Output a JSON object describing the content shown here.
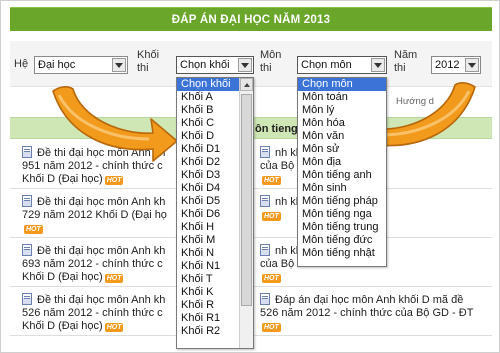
{
  "header": {
    "title": "ĐÁP ÁN ĐẠI HỌC NĂM 2013"
  },
  "filters": {
    "he_label": "Hệ",
    "he_value": "Đại học",
    "khoi_label_1": "Khối",
    "khoi_label_2": "thi",
    "khoi_value": "Chọn khối",
    "mon_label_1": "Môn",
    "mon_label_2": "thi",
    "mon_value": "Chọn môn",
    "nam_label_1": "Năm",
    "nam_label_2": "thi",
    "nam_value": "2012"
  },
  "hint_text": "Hướng d",
  "strip_text": "ôn tieng",
  "khoi_options": [
    "Chọn khối",
    "Khối A",
    "Khối B",
    "Khối C",
    "Khối D",
    "Khối D1",
    "Khối D2",
    "Khối D3",
    "Khối D4",
    "Khối D5",
    "Khối D6",
    "Khối H",
    "Khối M",
    "Khối N",
    "Khối N1",
    "Khối T",
    "Khối K",
    "Khối R",
    "Khối R1",
    "Khối R2"
  ],
  "mon_options": [
    "Chọn môn",
    "Môn toán",
    "Môn lý",
    "Môn hóa",
    "Môn văn",
    "Môn sử",
    "Môn địa",
    "Môn tiếng anh",
    "Môn sinh",
    "Môn tiếng pháp",
    "Môn tiếng nga",
    "Môn tiếng trung",
    "Môn tiếng đức",
    "Môn tiếng nhật"
  ],
  "rows": [
    {
      "left": [
        "Đề thi đại học môn Anh kh",
        "951 năm 2012 - chính thức c",
        "Khối D (Đại học)"
      ],
      "right": [
        "nh khối D mã đề",
        "của Bộ GD - ĐT"
      ]
    },
    {
      "left": [
        "Đề thi đại học môn Anh kh",
        "729 năm 2012 Khối D (Đại họ"
      ],
      "right": [
        "nh khối D mã đề",
        ""
      ]
    },
    {
      "left": [
        "Đề thi đại học môn Anh kh",
        "693 năm 2012 - chính thức c",
        "Khối D (Đại học)"
      ],
      "right": [
        "nh khối D mã đề",
        "của Bộ GD - ĐT"
      ]
    },
    {
      "left": [
        "Đề thi đại học môn Anh kh",
        "526 năm 2012 - chính thức c",
        "Khối D (Đại học)"
      ],
      "right": [
        "Đáp án đại học môn Anh khối D mã đề",
        "526 năm 2012 - chính thức của Bộ GD - ĐT"
      ]
    }
  ],
  "hot_label": "HOT",
  "colors": {
    "header_green": "#6aa62a",
    "strip_green": "#cfe7b4",
    "arrow_orange": "#f29a1c",
    "highlight_blue": "#3b74d6"
  }
}
